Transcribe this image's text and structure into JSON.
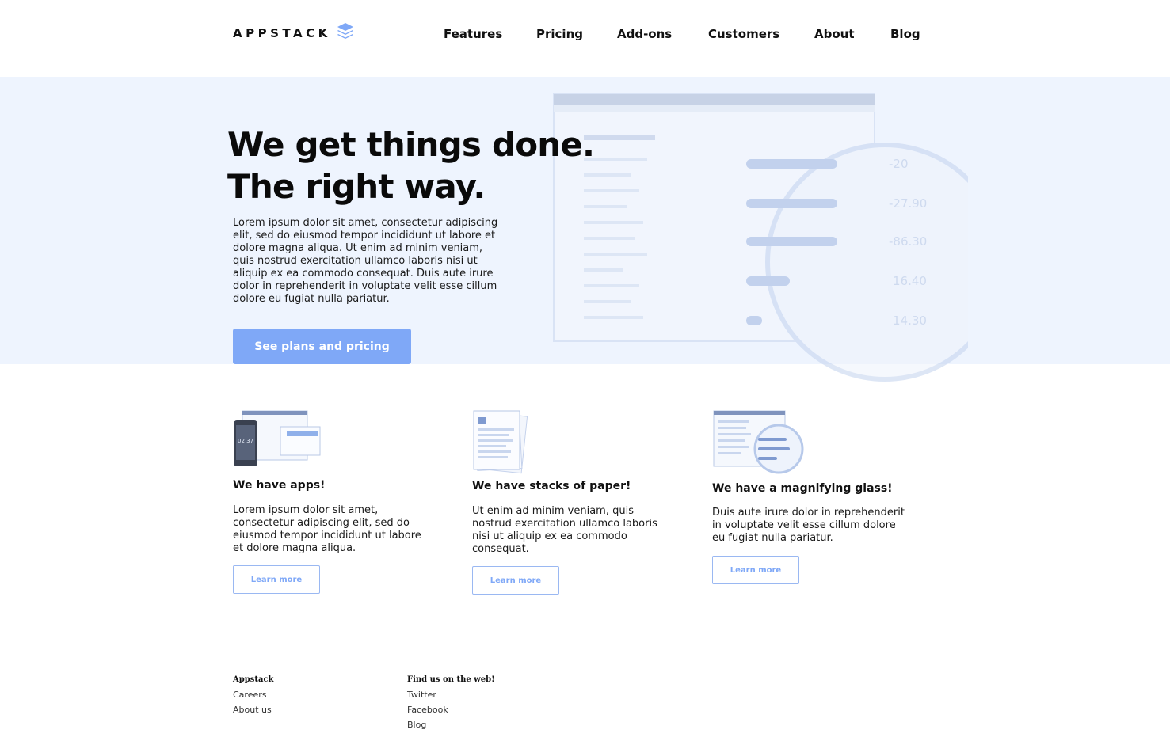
{
  "brand": {
    "name": "APPSTACK",
    "accent": "#7fa8f7",
    "hero_bg": "#eef4fe"
  },
  "nav": {
    "items": [
      "Features",
      "Pricing",
      "Add-ons",
      "Customers",
      "About",
      "Blog"
    ]
  },
  "hero": {
    "title_line1": "We get things done.",
    "title_line2": "The right way.",
    "body": "Lorem ipsum dolor sit amet, consectetur adipiscing elit, sed do eiusmod tempor incididunt ut labore et dolore magna aliqua. Ut enim ad minim veniam, quis nostrud exercitation ullamco laboris nisi ut aliquip ex ea commodo consequat. Duis aute irure dolor in reprehenderit in voluptate velit esse cillum dolore eu fugiat nulla pariatur.",
    "cta": "See plans and pricing"
  },
  "features": [
    {
      "title": "We have apps!",
      "body": "Lorem ipsum dolor sit amet, consectetur adipiscing elit, sed do eiusmod tempor incididunt ut labore et dolore magna aliqua.",
      "button": "Learn more"
    },
    {
      "title": "We have stacks of paper!",
      "body": "Ut enim ad minim veniam, quis nostrud exercitation ullamco laboris nisi ut aliquip ex ea commodo consequat.",
      "button": "Learn more"
    },
    {
      "title": "We have a magnifying glass!",
      "body": "Duis aute irure dolor in reprehenderit in voluptate velit esse cillum dolore eu fugiat nulla pariatur.",
      "button": "Learn more"
    }
  ],
  "footer": {
    "col1": {
      "heading": "Appstack",
      "links": [
        "Careers",
        "About us"
      ]
    },
    "col2": {
      "heading": "Find us on the web!",
      "links": [
        "Twitter",
        "Facebook",
        "Blog"
      ]
    }
  }
}
